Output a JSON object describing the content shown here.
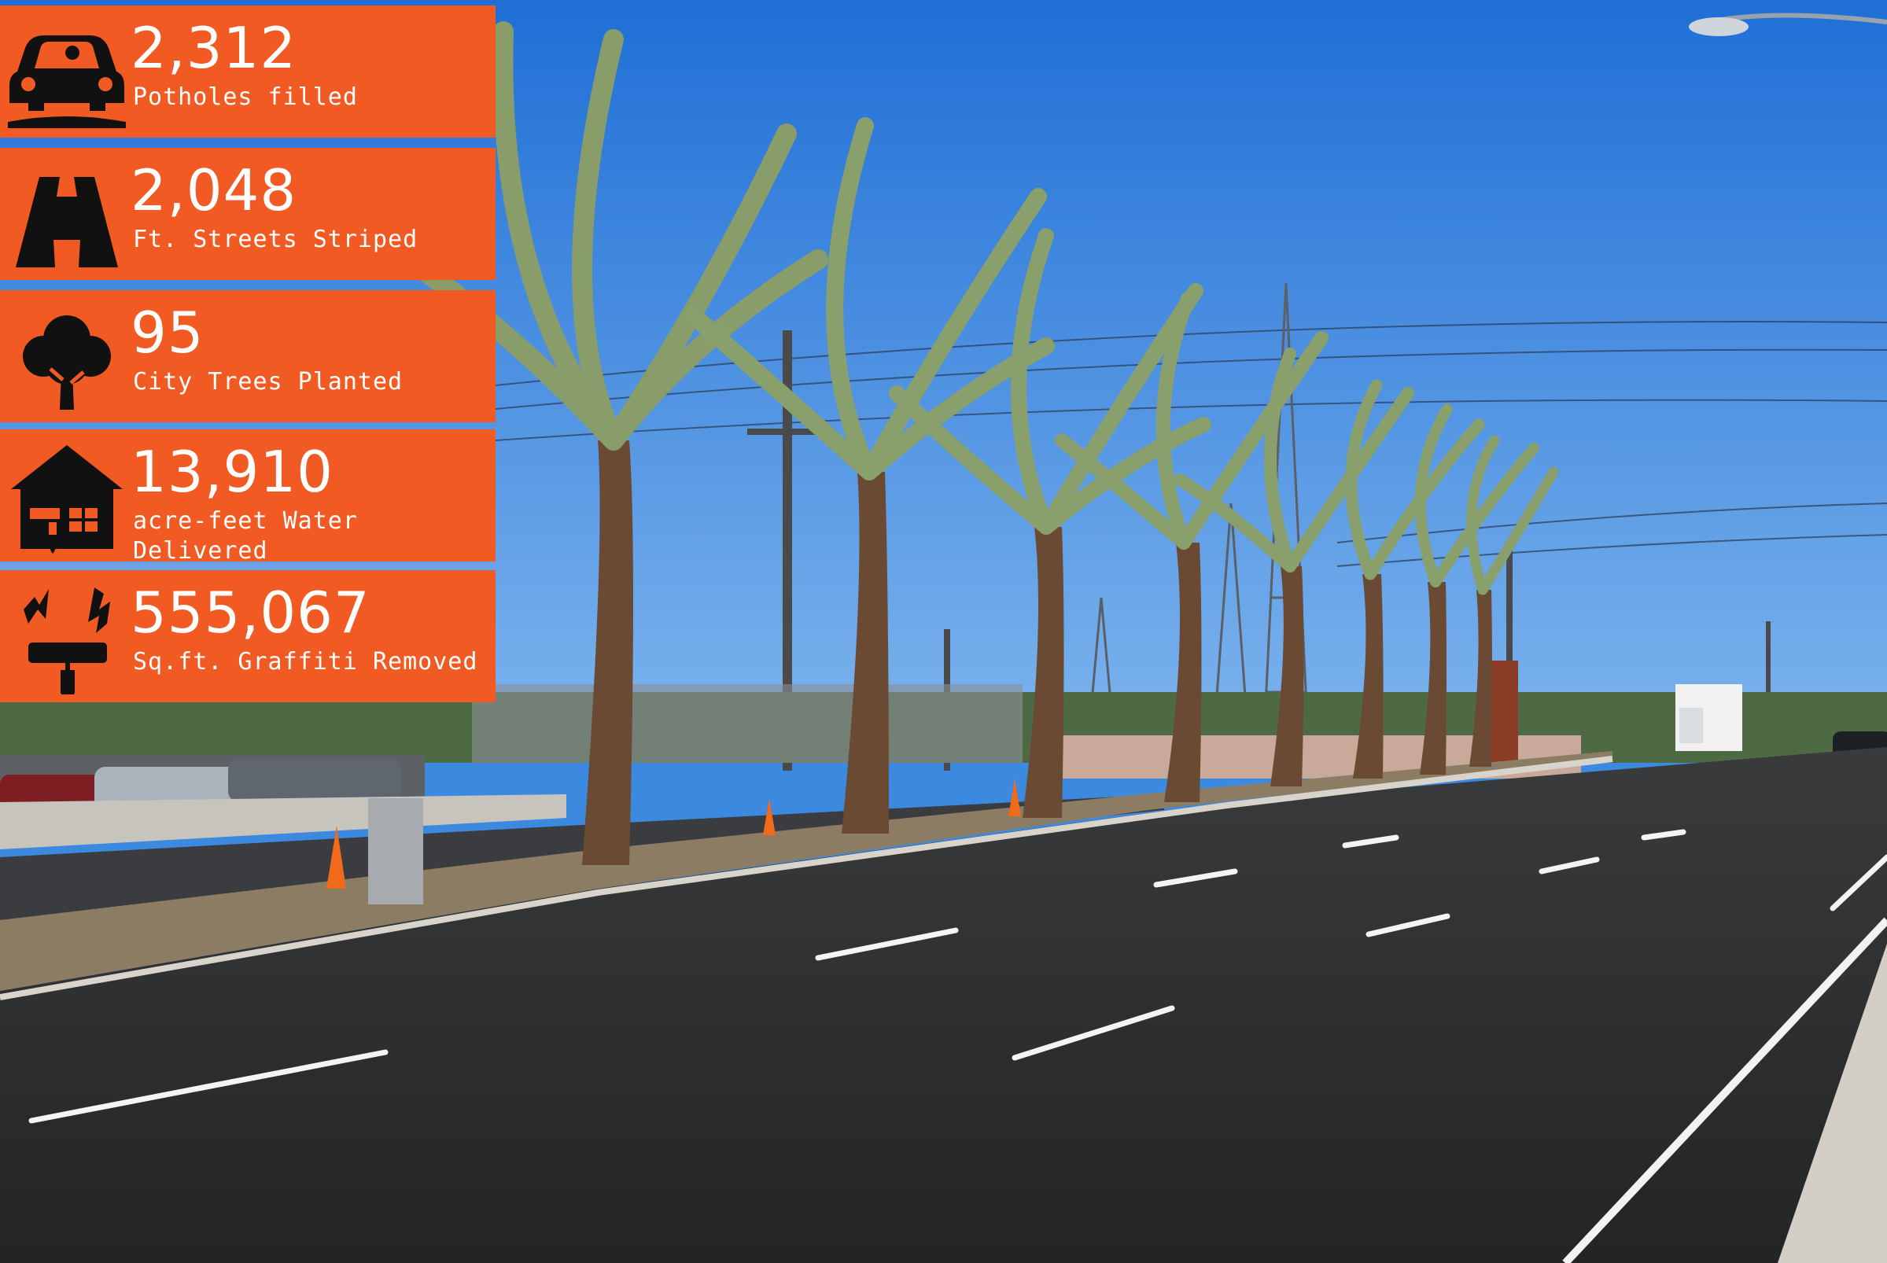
{
  "colors": {
    "panel": "#f15a22",
    "sky": "#3b8ae0",
    "asphalt": "#2b2c2e",
    "text": "#ffffff",
    "icon": "#111111"
  },
  "stats": [
    {
      "icon": "car-pothole-icon",
      "value": "2,312",
      "label": "Potholes filled"
    },
    {
      "icon": "road-icon",
      "value": "2,048",
      "label": "Ft. Streets Striped"
    },
    {
      "icon": "tree-icon",
      "value": "95",
      "label": "City Trees Planted"
    },
    {
      "icon": "house-water-icon",
      "value": "13,910",
      "label": "acre-feet Water Delivered"
    },
    {
      "icon": "paint-roller-icon",
      "value": "555,067",
      "label": "Sq.ft. Graffiti Removed"
    }
  ]
}
